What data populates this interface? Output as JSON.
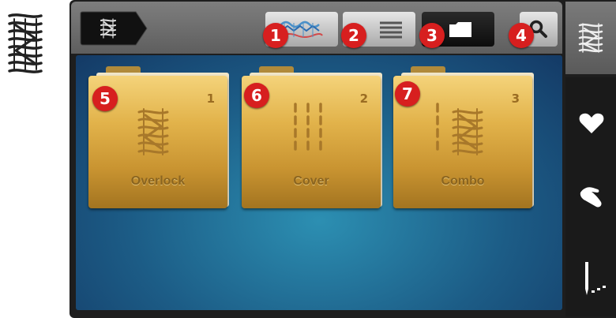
{
  "toolbar": {
    "stitch_category_icon": "serger-stitch-icon",
    "buttons": [
      {
        "id": "stitch-view",
        "icon": "stitch-pattern-icon",
        "badge": "1"
      },
      {
        "id": "list-view",
        "icon": "list-icon",
        "badge": "2"
      },
      {
        "id": "folder-view",
        "icon": "folder-icon",
        "badge": "3",
        "active": true
      },
      {
        "id": "search",
        "icon": "search-icon",
        "badge": "4"
      }
    ]
  },
  "folders": [
    {
      "badge": "5",
      "number": "1",
      "label": "Overlock"
    },
    {
      "badge": "6",
      "number": "2",
      "label": "Cover"
    },
    {
      "badge": "7",
      "number": "3",
      "label": "Combo"
    }
  ],
  "sidebar": [
    "serger-stitch-icon",
    "favorite-heart-icon",
    "personal-hand-icon",
    "needle-icon"
  ],
  "colors": {
    "badge": "#d71f1f",
    "folder": "#e2b34b",
    "content": "#1c5c86"
  }
}
